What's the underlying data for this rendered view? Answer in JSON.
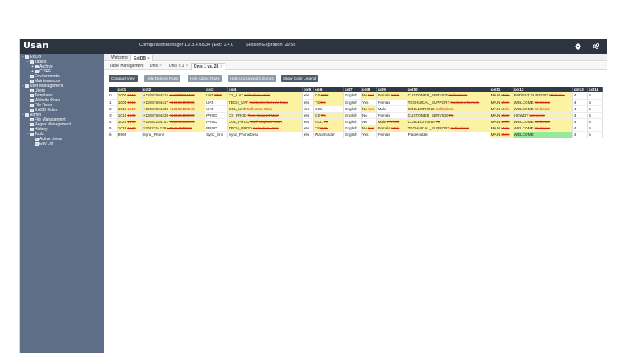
{
  "header": {
    "logo": "Usan",
    "app_info": "ConfigurationManager 1.2.3.470934 | Exc: 3.4.0",
    "session": "Session Expiration: 29:56",
    "settings_icon": "gear-icon",
    "user_icon": "user-key-icon"
  },
  "sidebar": {
    "items": [
      {
        "label": "ExtDB",
        "indent": 0,
        "toggle": "-",
        "icon": "folder"
      },
      {
        "label": "Tables",
        "indent": 1,
        "toggle": "-",
        "icon": "folder"
      },
      {
        "label": "Archive",
        "indent": 2,
        "toggle": "+",
        "icon": "folder"
      },
      {
        "label": "CORE",
        "indent": 2,
        "toggle": "+",
        "icon": "folder"
      },
      {
        "label": "Environments",
        "indent": 1,
        "toggle": "",
        "icon": "doc"
      },
      {
        "label": "Maintenances",
        "indent": 1,
        "toggle": "",
        "icon": "doc"
      },
      {
        "label": "User Management",
        "indent": 0,
        "toggle": "-",
        "icon": "folder"
      },
      {
        "label": "Users",
        "indent": 1,
        "toggle": "",
        "icon": "doc"
      },
      {
        "label": "Templates",
        "indent": 1,
        "toggle": "",
        "icon": "doc"
      },
      {
        "label": "Website Roles",
        "indent": 1,
        "toggle": "",
        "icon": "doc"
      },
      {
        "label": "File Roles",
        "indent": 1,
        "toggle": "",
        "icon": "doc"
      },
      {
        "label": "ExtDB Roles",
        "indent": 1,
        "toggle": "",
        "icon": "doc"
      },
      {
        "label": "Admin",
        "indent": 0,
        "toggle": "-",
        "icon": "folder"
      },
      {
        "label": "File Management",
        "indent": 1,
        "toggle": "",
        "icon": "doc"
      },
      {
        "label": "Regex Management",
        "indent": 1,
        "toggle": "",
        "icon": "doc"
      },
      {
        "label": "History",
        "indent": 1,
        "toggle": "",
        "icon": "doc"
      },
      {
        "label": "Tools",
        "indent": 1,
        "toggle": "-",
        "icon": "folder"
      },
      {
        "label": "Active Users",
        "indent": 2,
        "toggle": "",
        "icon": "doc"
      },
      {
        "label": "Env Diff",
        "indent": 2,
        "toggle": "",
        "icon": "doc"
      }
    ]
  },
  "tabs": [
    {
      "label": "Welcome",
      "active": false
    },
    {
      "label": "ExtDB",
      "active": true,
      "closable": true
    }
  ],
  "subtabs": [
    {
      "label": "Table Management",
      "closable": false,
      "active": false
    },
    {
      "label": "Dnis",
      "closable": true,
      "active": false
    },
    {
      "label": "Dnis V.1",
      "closable": true,
      "active": false
    },
    {
      "label": "Dnis 1 vs. 28",
      "closable": true,
      "active": true
    }
  ],
  "toolbar": {
    "buttons": [
      {
        "label": "Compact View",
        "style": "dark"
      },
      {
        "label": "Hide Deleted Rows",
        "style": "light"
      },
      {
        "label": "Hide Added Rows",
        "style": "light"
      },
      {
        "label": "Hide Unchanged Columns",
        "style": "light"
      },
      {
        "label": "Show Color Legend",
        "style": "dark"
      }
    ]
  },
  "table": {
    "headers": [
      "",
      "col1",
      "col2",
      "col3",
      "col4",
      "col5",
      "col6",
      "col7",
      "col8",
      "col9",
      "col10",
      "col11",
      "col12",
      "col13",
      "col14"
    ],
    "rows": [
      [
        [
          "0",
          "w",
          ""
        ],
        [
          "1000",
          "y",
          "1010"
        ],
        [
          "+12087594415",
          "y",
          "+12087594420"
        ],
        [
          "UAT",
          "y",
          "DEV"
        ],
        [
          "CS_UAT",
          "y",
          "Collection Main"
        ],
        [
          "Yes",
          "w",
          ""
        ],
        [
          "CS",
          "y",
          "COL"
        ],
        [
          "English",
          "w",
          ""
        ],
        [
          "No",
          "y",
          "Yes"
        ],
        [
          "Female",
          "y",
          "Male"
        ],
        [
          "CUSTOMER_SERVICE",
          "y",
          "Collections"
        ],
        [
          "MAIN",
          "y",
          "Main"
        ],
        [
          "PATIENT SUPPORT",
          "y",
          "Welcome"
        ],
        [
          "4",
          "w",
          ""
        ],
        [
          "5",
          "w",
          ""
        ]
      ],
      [
        [
          "1",
          "w",
          ""
        ],
        [
          "1005",
          "y",
          "1015"
        ],
        [
          "+12087594417",
          "y",
          "+16464400905"
        ],
        [
          "UAT",
          "w",
          ""
        ],
        [
          "TECH_UAT",
          "y",
          "Customer Service Main"
        ],
        [
          "Yes",
          "w",
          ""
        ],
        [
          "TS",
          "y",
          "CS"
        ],
        [
          "English",
          "w",
          ""
        ],
        [
          "Yes",
          "w",
          ""
        ],
        [
          "Female",
          "w",
          ""
        ],
        [
          "TECHNICAL_SUPPORT",
          "y",
          "CustomerService"
        ],
        [
          "MAIN",
          "y",
          "Main"
        ],
        [
          "WELCOME",
          "y",
          "Welcome"
        ],
        [
          "4",
          "w",
          ""
        ],
        [
          "5",
          "w",
          ""
        ]
      ],
      [
        [
          "2",
          "w",
          ""
        ],
        [
          "1010",
          "y",
          "1020"
        ],
        [
          "+12087594430",
          "y",
          "+16464400943"
        ],
        [
          "UAT",
          "w",
          ""
        ],
        [
          "COL_UAT",
          "y",
          "Collection Main"
        ],
        [
          "Yes",
          "w",
          ""
        ],
        [
          "COL",
          "w",
          ""
        ],
        [
          "English",
          "w",
          ""
        ],
        [
          "No",
          "y",
          "Yes"
        ],
        [
          "Male",
          "w",
          ""
        ],
        [
          "COLLECTIONS",
          "y",
          "Collections"
        ],
        [
          "MAIN",
          "y",
          "Main"
        ],
        [
          "WELCOME",
          "y",
          "Welcome"
        ],
        [
          "4",
          "w",
          ""
        ],
        [
          "5",
          "w",
          ""
        ]
      ],
      [
        [
          "3",
          "w",
          ""
        ],
        [
          "1015",
          "y",
          "1030"
        ],
        [
          "+12087594439",
          "y",
          "+16464400909"
        ],
        [
          "PROD",
          "w",
          ""
        ],
        [
          "CS_PROD",
          "y",
          "Tech Support Main"
        ],
        [
          "Yes",
          "w",
          ""
        ],
        [
          "CS",
          "y",
          "TS"
        ],
        [
          "English",
          "w",
          ""
        ],
        [
          "No",
          "w",
          ""
        ],
        [
          "Female",
          "w",
          ""
        ],
        [
          "CUSTOMER_SERVICE",
          "y",
          "TS"
        ],
        [
          "MAIN",
          "y",
          "Main"
        ],
        [
          "HOWDY",
          "y",
          "Welcome"
        ],
        [
          "4",
          "w",
          ""
        ],
        [
          "5",
          "w",
          ""
        ]
      ],
      [
        [
          "4",
          "w",
          ""
        ],
        [
          "1025",
          "y",
          "1035"
        ],
        [
          "+12082154141",
          "y",
          "+16464400934"
        ],
        [
          "PROD",
          "w",
          ""
        ],
        [
          "COL_PROD",
          "y",
          "Tech Support Main"
        ],
        [
          "Yes",
          "w",
          ""
        ],
        [
          "COL",
          "y",
          "TS"
        ],
        [
          "English",
          "w",
          ""
        ],
        [
          "No",
          "w",
          ""
        ],
        [
          "Male",
          "y",
          "Female"
        ],
        [
          "COLLECTIONS",
          "y",
          "TS"
        ],
        [
          "MAIN",
          "y",
          "Main"
        ],
        [
          "WELCOME",
          "y",
          "Welcome"
        ],
        [
          "4",
          "w",
          ""
        ],
        [
          "5",
          "w",
          ""
        ]
      ],
      [
        [
          "5",
          "w",
          ""
        ],
        [
          "1029",
          "y",
          "1040"
        ],
        [
          "12082154139",
          "y",
          "+16464400847"
        ],
        [
          "PROD",
          "w",
          ""
        ],
        [
          "TECH_PROD",
          "y",
          "Collection Main"
        ],
        [
          "Yes",
          "w",
          ""
        ],
        [
          "TS",
          "y",
          "COL"
        ],
        [
          "English",
          "w",
          ""
        ],
        [
          "No",
          "y",
          "Yes"
        ],
        [
          "Female",
          "y",
          "Male"
        ],
        [
          "TECHNICAL_SUPPORT",
          "y",
          "Collections"
        ],
        [
          "MAIN",
          "y",
          "Main"
        ],
        [
          "WELCOME",
          "y",
          "Welcome"
        ],
        [
          "4",
          "w",
          ""
        ],
        [
          "5",
          "w",
          ""
        ]
      ],
      [
        [
          "6",
          "w",
          ""
        ],
        [
          "9999",
          "w",
          ""
        ],
        [
          "Sync_Phone",
          "w",
          ""
        ],
        [
          "Sync_Env",
          "w",
          ""
        ],
        [
          "Sync_PhoneDesc",
          "w",
          ""
        ],
        [
          "Yes",
          "w",
          ""
        ],
        [
          "Placeholder",
          "w",
          ""
        ],
        [
          "English",
          "w",
          ""
        ],
        [
          "Yes",
          "w",
          ""
        ],
        [
          "Female",
          "w",
          ""
        ],
        [
          "PlaceHolder",
          "w",
          ""
        ],
        [
          "MAIN",
          "y",
          "Main"
        ],
        [
          "WELCOME",
          "g",
          ""
        ],
        [
          "4",
          "w",
          ""
        ],
        [
          "5",
          "w",
          ""
        ]
      ]
    ]
  }
}
